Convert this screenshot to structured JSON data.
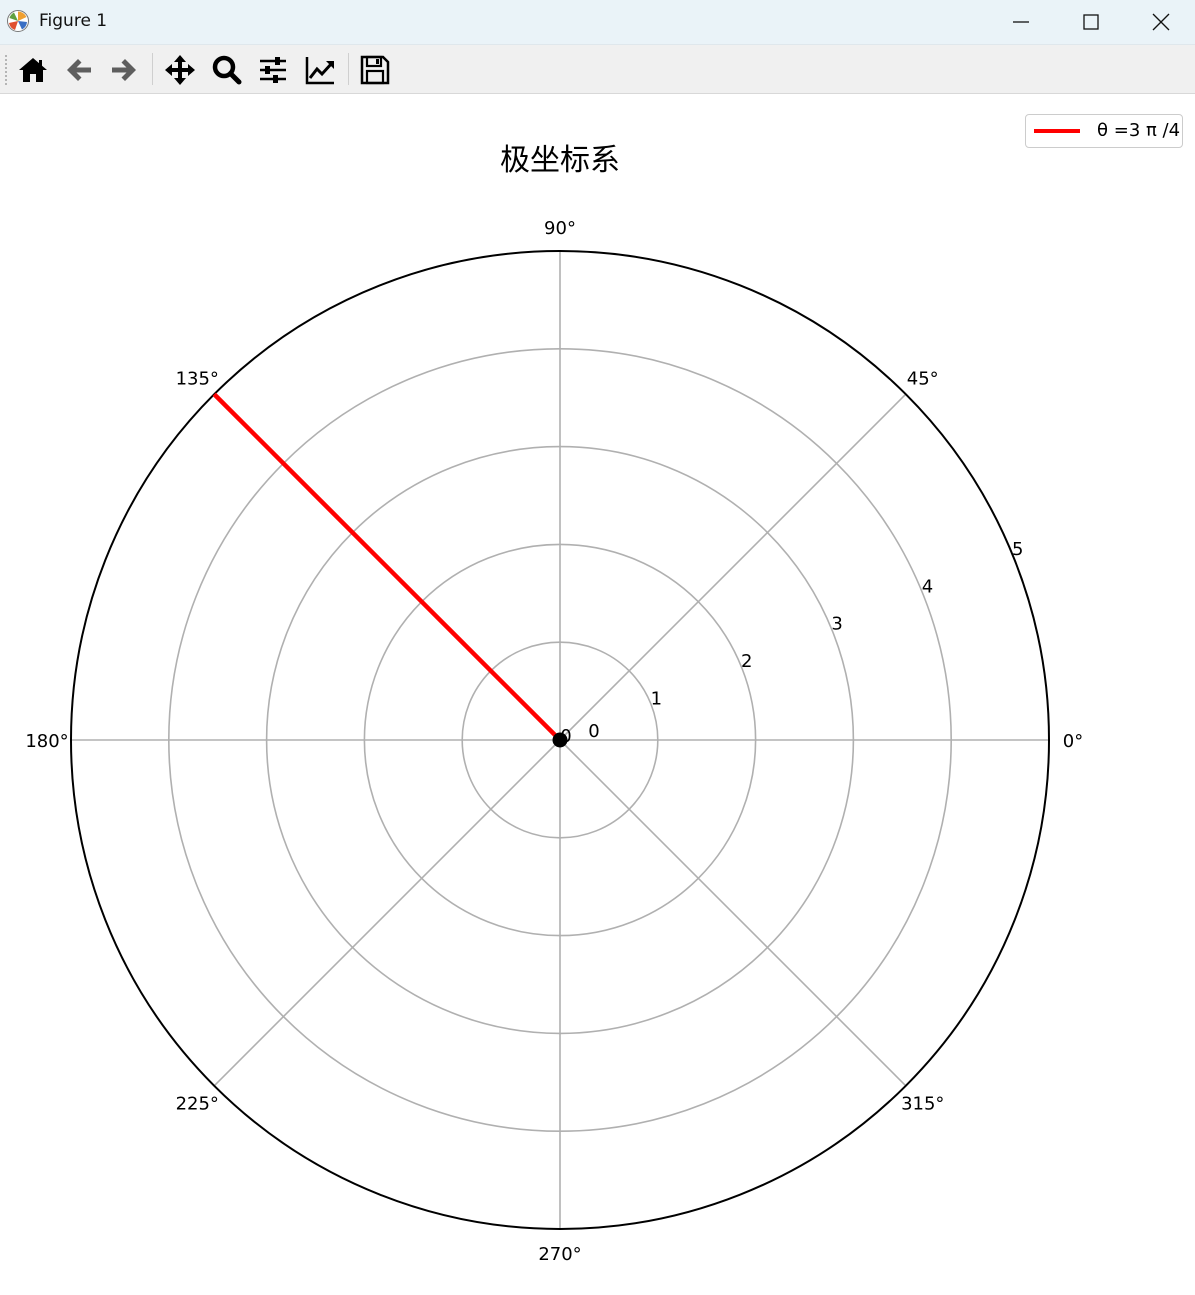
{
  "window": {
    "title": "Figure 1"
  },
  "toolbar": {
    "buttons": [
      {
        "name": "home-button",
        "icon": "home-icon"
      },
      {
        "name": "back-button",
        "icon": "arrow-left-icon"
      },
      {
        "name": "forward-button",
        "icon": "arrow-right-icon"
      },
      {
        "name": "pan-button",
        "icon": "move-icon"
      },
      {
        "name": "zoom-button",
        "icon": "magnifier-icon"
      },
      {
        "name": "subplots-button",
        "icon": "sliders-icon"
      },
      {
        "name": "axes-button",
        "icon": "line-chart-icon"
      },
      {
        "name": "save-button",
        "icon": "floppy-disk-icon"
      }
    ]
  },
  "chart_data": {
    "type": "polar",
    "title": "极坐标系",
    "angle_ticks": [
      {
        "deg": 0,
        "label": "0°"
      },
      {
        "deg": 45,
        "label": "45°"
      },
      {
        "deg": 90,
        "label": "90°"
      },
      {
        "deg": 135,
        "label": "135°"
      },
      {
        "deg": 180,
        "label": "180°"
      },
      {
        "deg": 225,
        "label": "225°"
      },
      {
        "deg": 270,
        "label": "270°"
      },
      {
        "deg": 315,
        "label": "315°"
      }
    ],
    "radial_ticks": [
      {
        "value": 0,
        "label": "0"
      },
      {
        "value": 1,
        "label": "1"
      },
      {
        "value": 2,
        "label": "2"
      },
      {
        "value": 3,
        "label": "3"
      },
      {
        "value": 4,
        "label": "4"
      },
      {
        "value": 5,
        "label": "5"
      }
    ],
    "rlim": [
      0,
      5
    ],
    "grid": true,
    "origin_label": "0",
    "series": [
      {
        "name": "θ =3 π /4",
        "theta_deg": 135,
        "r": [
          0,
          5
        ],
        "color": "#ff0000"
      }
    ],
    "point": {
      "theta_deg": 0,
      "r": 0,
      "color": "#000000"
    },
    "legend_position": "top-right"
  }
}
